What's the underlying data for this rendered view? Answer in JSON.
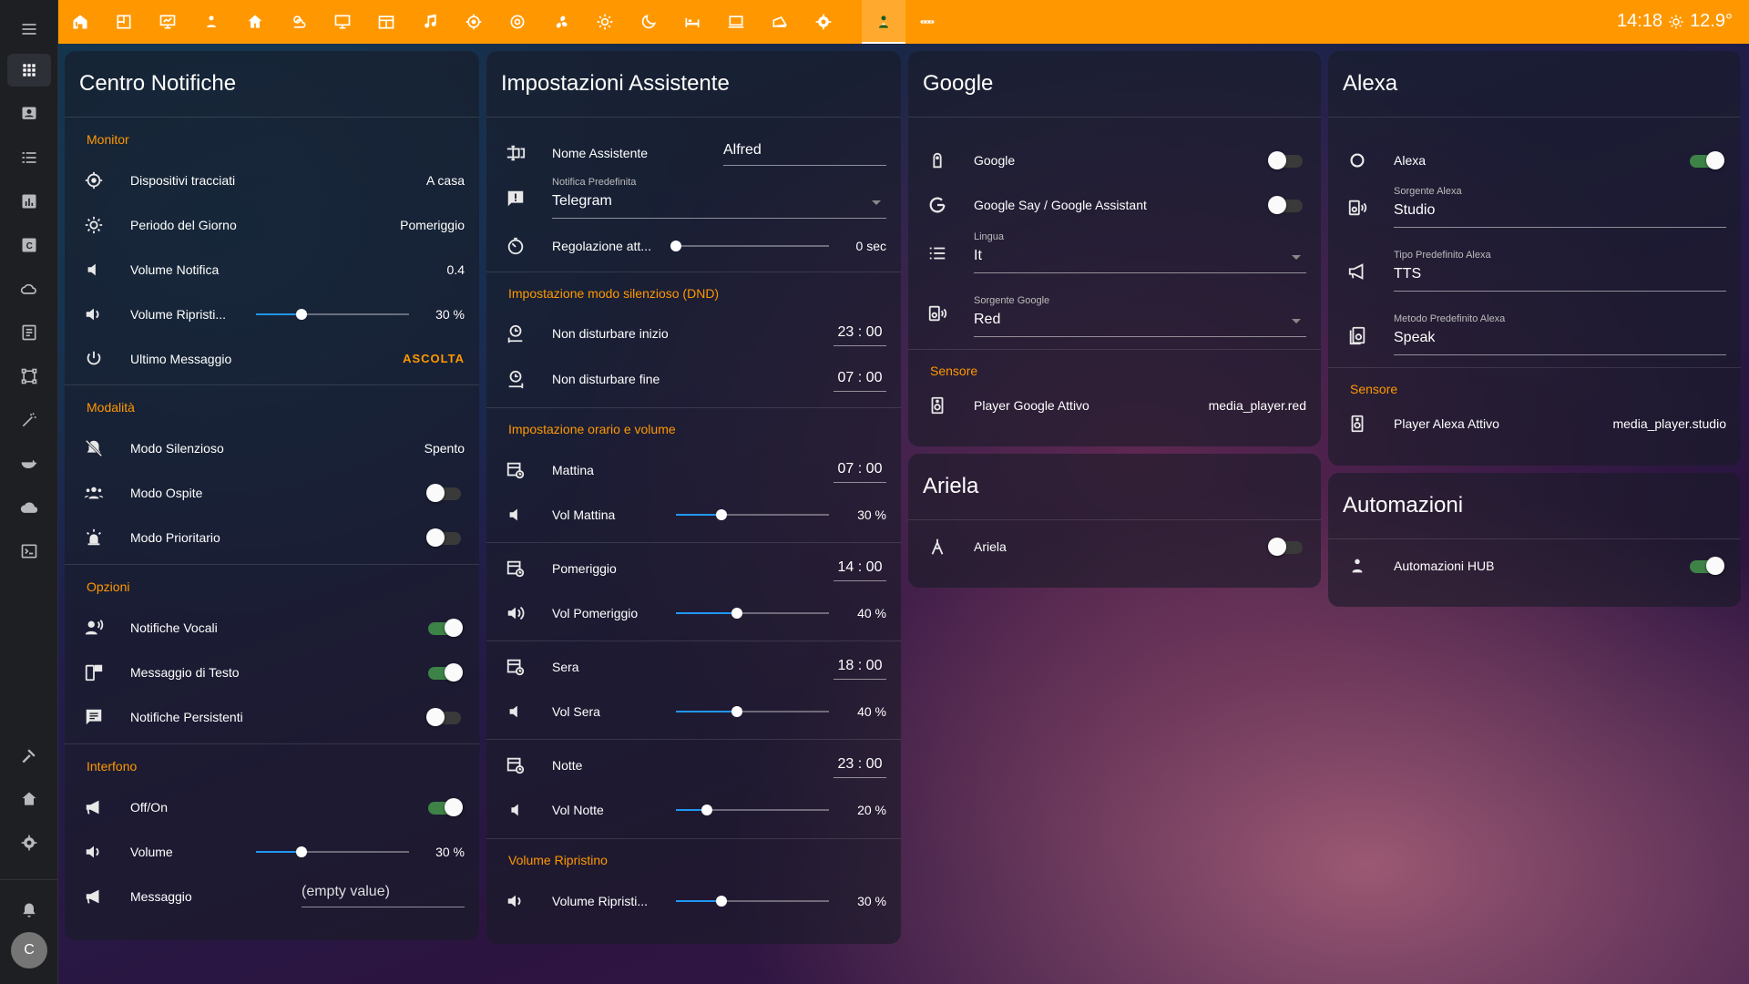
{
  "topbar": {
    "time": "14:18",
    "temperature": "12.9°"
  },
  "sidebar": {
    "user_initial": "C"
  },
  "notifiche": {
    "title": "Centro Notifiche",
    "monitor": {
      "header": "Monitor",
      "rows": [
        {
          "label": "Dispositivi tracciati",
          "value": "A casa"
        },
        {
          "label": "Periodo del Giorno",
          "value": "Pomeriggio"
        },
        {
          "label": "Volume Notifica",
          "value": "0.4"
        },
        {
          "label": "Volume Ripristi...",
          "value": "30 %",
          "level": 0.3
        },
        {
          "label": "Ultimo Messaggio",
          "value": "ASCOLTA"
        }
      ]
    },
    "modalita": {
      "header": "Modalità",
      "rows": [
        {
          "label": "Modo Silenzioso",
          "value": "Spento"
        },
        {
          "label": "Modo Ospite",
          "state": "off"
        },
        {
          "label": "Modo Prioritario",
          "state": "off"
        }
      ]
    },
    "opzioni": {
      "header": "Opzioni",
      "rows": [
        {
          "label": "Notifiche Vocali",
          "state": "on"
        },
        {
          "label": "Messaggio di Testo",
          "state": "on"
        },
        {
          "label": "Notifiche Persistenti",
          "state": "off"
        }
      ]
    },
    "interfono": {
      "header": "Interfono",
      "rows": [
        {
          "label": "Off/On",
          "state": "on"
        },
        {
          "label": "Volume",
          "value": "30 %",
          "level": 0.3
        },
        {
          "label": "Messaggio",
          "value": "(empty value)"
        }
      ]
    }
  },
  "assistente": {
    "title": "Impostazioni Assistente",
    "nome": {
      "label": "Nome Assistente",
      "value": "Alfred"
    },
    "notifica": {
      "small": "Notifica Predefinita",
      "value": "Telegram"
    },
    "regolazione": {
      "label": "Regolazione att...",
      "value": "0 sec",
      "level": 0.0
    },
    "dnd": {
      "header": "Impostazione modo silenzioso (DND)",
      "inizio": {
        "label": "Non disturbare inizio",
        "value": "23 : 00"
      },
      "fine": {
        "label": "Non disturbare fine",
        "value": "07 : 00"
      }
    },
    "orario": {
      "header": "Impostazione orario e volume",
      "rows": [
        {
          "label": "Mattina",
          "time": "07 : 00",
          "vol_label": "Vol Mattina",
          "vol": "30 %",
          "level": 0.3
        },
        {
          "label": "Pomeriggio",
          "time": "14 : 00",
          "vol_label": "Vol Pomeriggio",
          "vol": "40 %",
          "level": 0.4
        },
        {
          "label": "Sera",
          "time": "18 : 00",
          "vol_label": "Vol Sera",
          "vol": "40 %",
          "level": 0.4
        },
        {
          "label": "Notte",
          "time": "23 : 00",
          "vol_label": "Vol Notte",
          "vol": "20 %",
          "level": 0.2
        }
      ]
    },
    "ripristino": {
      "header": "Volume Ripristino",
      "label": "Volume Ripristi...",
      "value": "30 %",
      "level": 0.3
    }
  },
  "google": {
    "title": "Google",
    "google_toggle": {
      "label": "Google",
      "state": "off"
    },
    "say": {
      "label": "Google Say / Google Assistant",
      "state": "off"
    },
    "lingua": {
      "small": "Lingua",
      "value": "It"
    },
    "sorgente": {
      "small": "Sorgente Google",
      "value": "Red"
    },
    "sensore_header": "Sensore",
    "player": {
      "label": "Player Google Attivo",
      "value": "media_player.red"
    }
  },
  "ariela": {
    "title": "Ariela",
    "row": {
      "label": "Ariela",
      "state": "off"
    }
  },
  "alexa": {
    "title": "Alexa",
    "toggle": {
      "label": "Alexa",
      "state": "on"
    },
    "sorgente": {
      "small": "Sorgente Alexa",
      "value": "Studio"
    },
    "tipo": {
      "small": "Tipo Predefinito Alexa",
      "value": "TTS"
    },
    "metodo": {
      "small": "Metodo Predefinito Alexa",
      "value": "Speak"
    },
    "sensore_header": "Sensore",
    "player": {
      "label": "Player Alexa Attivo",
      "value": "media_player.studio"
    }
  },
  "automazioni": {
    "title": "Automazioni",
    "row": {
      "label": "Automazioni HUB",
      "state": "on"
    }
  }
}
